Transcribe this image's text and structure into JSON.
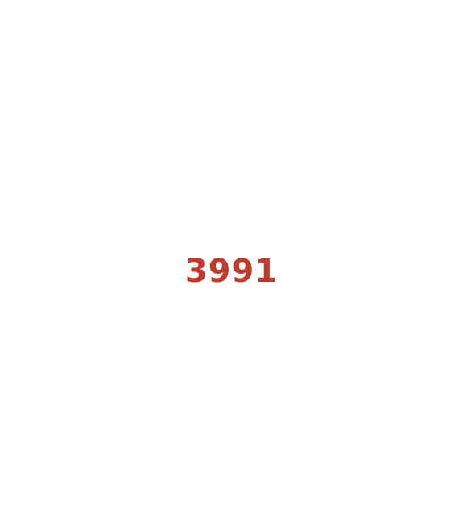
{
  "display": {
    "value": "3991",
    "color": "#c0392b"
  }
}
